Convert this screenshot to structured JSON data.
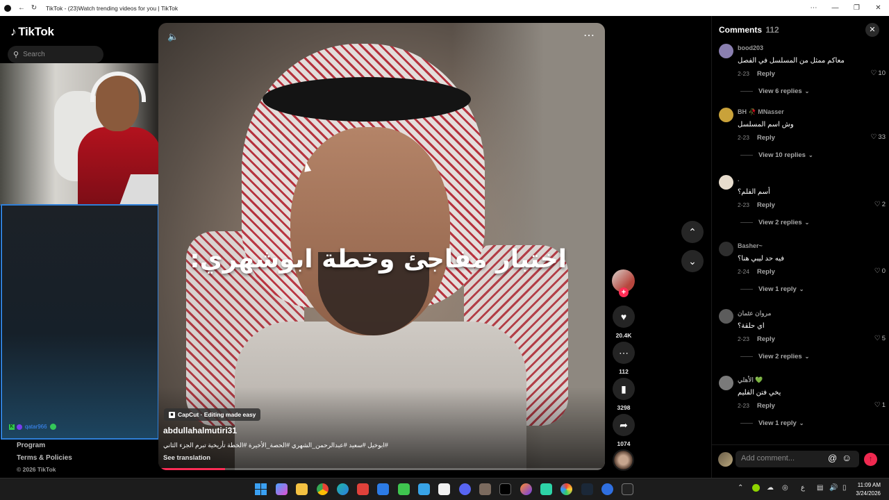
{
  "browser": {
    "title": "TikTok - (23)Watch trending videos for you | TikTok"
  },
  "sidebar": {
    "logo_text": "TikTok",
    "search_placeholder": "Search",
    "chat_username": "qatar966",
    "footer": {
      "program": "Program",
      "terms": "Terms & Policies",
      "copyright": "© 2026 TikTok"
    }
  },
  "video": {
    "overlay_text": "اختبار مفاجئ وخطة ابوشهري:",
    "capcut_label": "CapCut · Editing made easy",
    "author": "abdullahalmutiri31",
    "description": "#ابوخيل #سعيد #عبدالرحمن_الشهري #الحصة_الأخيرة #الخطة تأريخية تبرم الجزء الثاني",
    "see_translation": "See translation",
    "progress": 0.15
  },
  "actions": {
    "likes": "20.4K",
    "comments": "112",
    "saves": "3298",
    "shares": "1074"
  },
  "comments_panel": {
    "title": "Comments",
    "count": "112",
    "add_placeholder": "Add comment...",
    "items": [
      {
        "user": "bood203",
        "text": "معاكم ممثل من المسلسل في الفصل",
        "date": "2-23",
        "reply": "Reply",
        "likes": "10",
        "view": "View 6 replies",
        "avatar_color": "#8a7fb0"
      },
      {
        "user": "BH 🥀 MNasser",
        "text": "وش اسم المسلسل",
        "date": "2-23",
        "reply": "Reply",
        "likes": "33",
        "view": "View 10 replies",
        "avatar_color": "#c9a23a"
      },
      {
        "user": ".",
        "text": "أسم الفلم؟",
        "date": "2-23",
        "reply": "Reply",
        "likes": "2",
        "view": "View 2 replies",
        "avatar_color": "#e7dccd"
      },
      {
        "user": "Basher~",
        "text": "فيه حد ليبي هنا؟",
        "date": "2-24",
        "reply": "Reply",
        "likes": "0",
        "view": "View 1 reply",
        "avatar_color": "#2e2e2e"
      },
      {
        "user": "مروان عثمان",
        "text": "اي حلقة؟",
        "date": "2-23",
        "reply": "Reply",
        "likes": "5",
        "view": "View 2 replies",
        "avatar_color": "#5c5c5c"
      },
      {
        "user": "الأهلي 💚",
        "text": "يخي فتن الفليم",
        "date": "2-23",
        "reply": "Reply",
        "likes": "1",
        "view": "View 1 reply",
        "avatar_color": "#7a7a7a"
      }
    ]
  },
  "taskbar": {
    "time": "11:09 AM",
    "date": "3/24/2026",
    "lang": "ع"
  },
  "colors": {
    "accent": "#fe2c55",
    "panel_bg": "#000000"
  }
}
